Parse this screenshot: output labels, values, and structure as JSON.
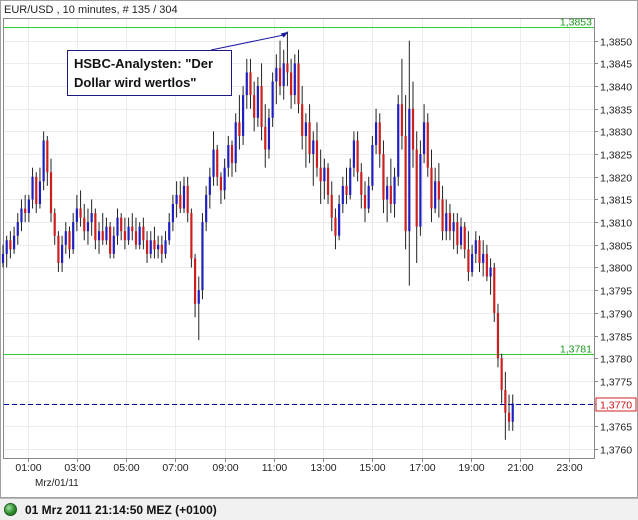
{
  "header": {
    "title": "EUR/USD , 10 minutes, # 135 / 304"
  },
  "annotation": {
    "line1": "HSBC-Analysten: \"Der",
    "line2": "Dollar wird wertlos\""
  },
  "date_label": "Mrz/01/11",
  "status": {
    "text": "01 Mrz 2011 21:14:50  MEZ (+0100)"
  },
  "colors": {
    "up": "#2020c0",
    "down": "#cc2020",
    "hline": "#33cc33",
    "current": "#0000a0",
    "current_box": "#cc2020"
  },
  "chart_data": {
    "type": "candlestick",
    "instrument": "EUR/USD",
    "interval": "10 minutes",
    "xlim": [
      0,
      24
    ],
    "ylim": [
      1.3758,
      1.3855
    ],
    "x_ticks": [
      {
        "v": 1,
        "label": "01:00"
      },
      {
        "v": 3,
        "label": "03:00"
      },
      {
        "v": 5,
        "label": "05:00"
      },
      {
        "v": 7,
        "label": "07:00"
      },
      {
        "v": 9,
        "label": "09:00"
      },
      {
        "v": 11,
        "label": "11:00"
      },
      {
        "v": 13,
        "label": "13:00"
      },
      {
        "v": 15,
        "label": "15:00"
      },
      {
        "v": 17,
        "label": "17:00"
      },
      {
        "v": 19,
        "label": "19:00"
      },
      {
        "v": 21,
        "label": "21:00"
      },
      {
        "v": 23,
        "label": "23:00"
      }
    ],
    "y_ticks": [
      {
        "v": 1.376,
        "label": "1,3760"
      },
      {
        "v": 1.3765,
        "label": "1,3765"
      },
      {
        "v": 1.377,
        "label": "1,3770"
      },
      {
        "v": 1.3775,
        "label": "1,3775"
      },
      {
        "v": 1.378,
        "label": "1,3780"
      },
      {
        "v": 1.3785,
        "label": "1,3785"
      },
      {
        "v": 1.379,
        "label": "1,3790"
      },
      {
        "v": 1.3795,
        "label": "1,3795"
      },
      {
        "v": 1.38,
        "label": "1,3800"
      },
      {
        "v": 1.3805,
        "label": "1,3805"
      },
      {
        "v": 1.381,
        "label": "1,3810"
      },
      {
        "v": 1.3815,
        "label": "1,3815"
      },
      {
        "v": 1.382,
        "label": "1,3820"
      },
      {
        "v": 1.3825,
        "label": "1,3825"
      },
      {
        "v": 1.383,
        "label": "1,3830"
      },
      {
        "v": 1.3835,
        "label": "1,3835"
      },
      {
        "v": 1.384,
        "label": "1,3840"
      },
      {
        "v": 1.3845,
        "label": "1,3845"
      },
      {
        "v": 1.385,
        "label": "1,3850"
      }
    ],
    "hlines": [
      {
        "value": 1.3853,
        "label": "1,3853"
      },
      {
        "value": 1.3781,
        "label": "1,3781"
      }
    ],
    "current_price": {
      "value": 1.377,
      "label": "1,3770"
    },
    "annotation_point": {
      "time": 11.6,
      "value": 1.3852
    },
    "candles": [
      {
        "t": 0.0,
        "o": 1.3801,
        "h": 1.3805,
        "l": 1.38,
        "c": 1.3803
      },
      {
        "t": 0.15,
        "o": 1.3803,
        "h": 1.3807,
        "l": 1.38,
        "c": 1.3806
      },
      {
        "t": 0.3,
        "o": 1.3806,
        "h": 1.3808,
        "l": 1.3802,
        "c": 1.3804
      },
      {
        "t": 0.45,
        "o": 1.3804,
        "h": 1.3809,
        "l": 1.3803,
        "c": 1.3807
      },
      {
        "t": 0.6,
        "o": 1.3807,
        "h": 1.3812,
        "l": 1.3805,
        "c": 1.381
      },
      {
        "t": 0.75,
        "o": 1.381,
        "h": 1.3815,
        "l": 1.3808,
        "c": 1.3813
      },
      {
        "t": 0.9,
        "o": 1.3813,
        "h": 1.3816,
        "l": 1.381,
        "c": 1.3812
      },
      {
        "t": 1.05,
        "o": 1.3812,
        "h": 1.3816,
        "l": 1.381,
        "c": 1.3815
      },
      {
        "t": 1.2,
        "o": 1.3815,
        "h": 1.3822,
        "l": 1.3813,
        "c": 1.382
      },
      {
        "t": 1.35,
        "o": 1.382,
        "h": 1.3821,
        "l": 1.3812,
        "c": 1.3814
      },
      {
        "t": 1.5,
        "o": 1.3814,
        "h": 1.3822,
        "l": 1.3813,
        "c": 1.3819
      },
      {
        "t": 1.65,
        "o": 1.3819,
        "h": 1.383,
        "l": 1.3817,
        "c": 1.3828
      },
      {
        "t": 1.8,
        "o": 1.3828,
        "h": 1.3829,
        "l": 1.3818,
        "c": 1.3821
      },
      {
        "t": 1.95,
        "o": 1.3821,
        "h": 1.3824,
        "l": 1.381,
        "c": 1.3812
      },
      {
        "t": 2.1,
        "o": 1.3812,
        "h": 1.3813,
        "l": 1.3805,
        "c": 1.3807
      },
      {
        "t": 2.25,
        "o": 1.3807,
        "h": 1.3808,
        "l": 1.3799,
        "c": 1.3801
      },
      {
        "t": 2.4,
        "o": 1.3801,
        "h": 1.3807,
        "l": 1.3799,
        "c": 1.3805
      },
      {
        "t": 2.55,
        "o": 1.3805,
        "h": 1.381,
        "l": 1.3803,
        "c": 1.3808
      },
      {
        "t": 2.7,
        "o": 1.3808,
        "h": 1.3809,
        "l": 1.3802,
        "c": 1.3804
      },
      {
        "t": 2.85,
        "o": 1.3804,
        "h": 1.3812,
        "l": 1.3803,
        "c": 1.381
      },
      {
        "t": 3.0,
        "o": 1.381,
        "h": 1.3816,
        "l": 1.3808,
        "c": 1.3813
      },
      {
        "t": 3.15,
        "o": 1.3813,
        "h": 1.3817,
        "l": 1.3809,
        "c": 1.3811
      },
      {
        "t": 3.3,
        "o": 1.3811,
        "h": 1.3814,
        "l": 1.3806,
        "c": 1.3808
      },
      {
        "t": 3.45,
        "o": 1.3808,
        "h": 1.3813,
        "l": 1.3805,
        "c": 1.381
      },
      {
        "t": 3.6,
        "o": 1.381,
        "h": 1.3815,
        "l": 1.3807,
        "c": 1.3812
      },
      {
        "t": 3.75,
        "o": 1.3812,
        "h": 1.3813,
        "l": 1.3804,
        "c": 1.3806
      },
      {
        "t": 3.9,
        "o": 1.3806,
        "h": 1.381,
        "l": 1.3803,
        "c": 1.3808
      },
      {
        "t": 4.05,
        "o": 1.3808,
        "h": 1.3812,
        "l": 1.3805,
        "c": 1.3806
      },
      {
        "t": 4.2,
        "o": 1.3806,
        "h": 1.3811,
        "l": 1.3805,
        "c": 1.3809
      },
      {
        "t": 4.35,
        "o": 1.3809,
        "h": 1.381,
        "l": 1.3802,
        "c": 1.3803
      },
      {
        "t": 4.5,
        "o": 1.3803,
        "h": 1.3809,
        "l": 1.3802,
        "c": 1.3807
      },
      {
        "t": 4.65,
        "o": 1.3807,
        "h": 1.3813,
        "l": 1.3805,
        "c": 1.3811
      },
      {
        "t": 4.8,
        "o": 1.3811,
        "h": 1.3812,
        "l": 1.3806,
        "c": 1.3808
      },
      {
        "t": 4.95,
        "o": 1.3808,
        "h": 1.3811,
        "l": 1.3804,
        "c": 1.3806
      },
      {
        "t": 5.1,
        "o": 1.3806,
        "h": 1.3811,
        "l": 1.3805,
        "c": 1.3809
      },
      {
        "t": 5.25,
        "o": 1.3809,
        "h": 1.3812,
        "l": 1.3806,
        "c": 1.3808
      },
      {
        "t": 5.4,
        "o": 1.3808,
        "h": 1.3811,
        "l": 1.3804,
        "c": 1.3805
      },
      {
        "t": 5.55,
        "o": 1.3805,
        "h": 1.381,
        "l": 1.3804,
        "c": 1.3809
      },
      {
        "t": 5.7,
        "o": 1.3809,
        "h": 1.3811,
        "l": 1.3804,
        "c": 1.3806
      },
      {
        "t": 5.85,
        "o": 1.3806,
        "h": 1.3808,
        "l": 1.3801,
        "c": 1.3803
      },
      {
        "t": 6.0,
        "o": 1.3803,
        "h": 1.3808,
        "l": 1.3802,
        "c": 1.3806
      },
      {
        "t": 6.15,
        "o": 1.3806,
        "h": 1.3809,
        "l": 1.3802,
        "c": 1.3804
      },
      {
        "t": 6.3,
        "o": 1.3804,
        "h": 1.3807,
        "l": 1.3802,
        "c": 1.3805
      },
      {
        "t": 6.45,
        "o": 1.3805,
        "h": 1.3807,
        "l": 1.3801,
        "c": 1.3803
      },
      {
        "t": 6.6,
        "o": 1.3803,
        "h": 1.3808,
        "l": 1.3802,
        "c": 1.3806
      },
      {
        "t": 6.75,
        "o": 1.3806,
        "h": 1.3812,
        "l": 1.3805,
        "c": 1.381
      },
      {
        "t": 6.9,
        "o": 1.381,
        "h": 1.3816,
        "l": 1.3808,
        "c": 1.3814
      },
      {
        "t": 7.05,
        "o": 1.3814,
        "h": 1.3819,
        "l": 1.3811,
        "c": 1.3816
      },
      {
        "t": 7.2,
        "o": 1.3816,
        "h": 1.3819,
        "l": 1.3812,
        "c": 1.3813
      },
      {
        "t": 7.35,
        "o": 1.3813,
        "h": 1.382,
        "l": 1.3812,
        "c": 1.3818
      },
      {
        "t": 7.5,
        "o": 1.3818,
        "h": 1.382,
        "l": 1.381,
        "c": 1.3812
      },
      {
        "t": 7.65,
        "o": 1.3812,
        "h": 1.3813,
        "l": 1.38,
        "c": 1.3802
      },
      {
        "t": 7.8,
        "o": 1.3802,
        "h": 1.3803,
        "l": 1.3789,
        "c": 1.3792
      },
      {
        "t": 7.95,
        "o": 1.3792,
        "h": 1.3798,
        "l": 1.3784,
        "c": 1.3795
      },
      {
        "t": 8.1,
        "o": 1.3795,
        "h": 1.3812,
        "l": 1.3793,
        "c": 1.381
      },
      {
        "t": 8.25,
        "o": 1.381,
        "h": 1.3818,
        "l": 1.3808,
        "c": 1.3816
      },
      {
        "t": 8.4,
        "o": 1.3816,
        "h": 1.3822,
        "l": 1.3813,
        "c": 1.382
      },
      {
        "t": 8.55,
        "o": 1.382,
        "h": 1.383,
        "l": 1.3818,
        "c": 1.3826
      },
      {
        "t": 8.7,
        "o": 1.3826,
        "h": 1.3827,
        "l": 1.3818,
        "c": 1.382
      },
      {
        "t": 8.85,
        "o": 1.382,
        "h": 1.3821,
        "l": 1.3814,
        "c": 1.3817
      },
      {
        "t": 9.0,
        "o": 1.3817,
        "h": 1.3824,
        "l": 1.3815,
        "c": 1.3822
      },
      {
        "t": 9.15,
        "o": 1.3822,
        "h": 1.3829,
        "l": 1.382,
        "c": 1.3827
      },
      {
        "t": 9.3,
        "o": 1.3827,
        "h": 1.3828,
        "l": 1.382,
        "c": 1.3823
      },
      {
        "t": 9.45,
        "o": 1.3823,
        "h": 1.3834,
        "l": 1.3821,
        "c": 1.3832
      },
      {
        "t": 9.6,
        "o": 1.3832,
        "h": 1.3838,
        "l": 1.3826,
        "c": 1.3829
      },
      {
        "t": 9.75,
        "o": 1.3829,
        "h": 1.384,
        "l": 1.3827,
        "c": 1.3838
      },
      {
        "t": 9.9,
        "o": 1.3838,
        "h": 1.3846,
        "l": 1.3835,
        "c": 1.3843
      },
      {
        "t": 10.05,
        "o": 1.3843,
        "h": 1.3846,
        "l": 1.3835,
        "c": 1.3838
      },
      {
        "t": 10.2,
        "o": 1.3838,
        "h": 1.3841,
        "l": 1.383,
        "c": 1.3833
      },
      {
        "t": 10.35,
        "o": 1.3833,
        "h": 1.3842,
        "l": 1.3831,
        "c": 1.384
      },
      {
        "t": 10.5,
        "o": 1.384,
        "h": 1.3845,
        "l": 1.3828,
        "c": 1.3831
      },
      {
        "t": 10.65,
        "o": 1.3831,
        "h": 1.3836,
        "l": 1.3822,
        "c": 1.3826
      },
      {
        "t": 10.8,
        "o": 1.3826,
        "h": 1.3835,
        "l": 1.3824,
        "c": 1.3833
      },
      {
        "t": 10.95,
        "o": 1.3833,
        "h": 1.3843,
        "l": 1.3831,
        "c": 1.3841
      },
      {
        "t": 11.1,
        "o": 1.3841,
        "h": 1.3847,
        "l": 1.3836,
        "c": 1.3844
      },
      {
        "t": 11.25,
        "o": 1.3844,
        "h": 1.385,
        "l": 1.3838,
        "c": 1.384
      },
      {
        "t": 11.4,
        "o": 1.384,
        "h": 1.3848,
        "l": 1.3837,
        "c": 1.3845
      },
      {
        "t": 11.55,
        "o": 1.3845,
        "h": 1.3852,
        "l": 1.384,
        "c": 1.3843
      },
      {
        "t": 11.7,
        "o": 1.3843,
        "h": 1.3846,
        "l": 1.3835,
        "c": 1.3838
      },
      {
        "t": 11.85,
        "o": 1.3838,
        "h": 1.3847,
        "l": 1.3836,
        "c": 1.3845
      },
      {
        "t": 12.0,
        "o": 1.3845,
        "h": 1.3848,
        "l": 1.3834,
        "c": 1.3836
      },
      {
        "t": 12.15,
        "o": 1.3836,
        "h": 1.384,
        "l": 1.3826,
        "c": 1.3829
      },
      {
        "t": 12.3,
        "o": 1.3829,
        "h": 1.3834,
        "l": 1.3822,
        "c": 1.3832
      },
      {
        "t": 12.45,
        "o": 1.3832,
        "h": 1.3836,
        "l": 1.3823,
        "c": 1.3825
      },
      {
        "t": 12.6,
        "o": 1.3825,
        "h": 1.383,
        "l": 1.3818,
        "c": 1.3828
      },
      {
        "t": 12.75,
        "o": 1.3828,
        "h": 1.3832,
        "l": 1.382,
        "c": 1.3822
      },
      {
        "t": 12.9,
        "o": 1.3822,
        "h": 1.3826,
        "l": 1.3814,
        "c": 1.3819
      },
      {
        "t": 13.05,
        "o": 1.3819,
        "h": 1.3824,
        "l": 1.3815,
        "c": 1.3822
      },
      {
        "t": 13.2,
        "o": 1.3822,
        "h": 1.3823,
        "l": 1.3814,
        "c": 1.3816
      },
      {
        "t": 13.35,
        "o": 1.3816,
        "h": 1.3819,
        "l": 1.3808,
        "c": 1.3811
      },
      {
        "t": 13.5,
        "o": 1.3811,
        "h": 1.3813,
        "l": 1.3804,
        "c": 1.3807
      },
      {
        "t": 13.65,
        "o": 1.3807,
        "h": 1.3816,
        "l": 1.3806,
        "c": 1.3814
      },
      {
        "t": 13.8,
        "o": 1.3814,
        "h": 1.382,
        "l": 1.3812,
        "c": 1.3818
      },
      {
        "t": 13.95,
        "o": 1.3818,
        "h": 1.3822,
        "l": 1.3814,
        "c": 1.3816
      },
      {
        "t": 14.1,
        "o": 1.3816,
        "h": 1.3824,
        "l": 1.3815,
        "c": 1.3822
      },
      {
        "t": 14.25,
        "o": 1.3822,
        "h": 1.383,
        "l": 1.382,
        "c": 1.3828
      },
      {
        "t": 14.4,
        "o": 1.3828,
        "h": 1.383,
        "l": 1.3819,
        "c": 1.3821
      },
      {
        "t": 14.55,
        "o": 1.3821,
        "h": 1.3823,
        "l": 1.3813,
        "c": 1.3816
      },
      {
        "t": 14.7,
        "o": 1.3816,
        "h": 1.3819,
        "l": 1.381,
        "c": 1.3813
      },
      {
        "t": 14.85,
        "o": 1.3813,
        "h": 1.382,
        "l": 1.3812,
        "c": 1.3818
      },
      {
        "t": 15.0,
        "o": 1.3818,
        "h": 1.3829,
        "l": 1.3817,
        "c": 1.3827
      },
      {
        "t": 15.15,
        "o": 1.3827,
        "h": 1.3835,
        "l": 1.3825,
        "c": 1.3832
      },
      {
        "t": 15.3,
        "o": 1.3832,
        "h": 1.3834,
        "l": 1.3822,
        "c": 1.3825
      },
      {
        "t": 15.45,
        "o": 1.3825,
        "h": 1.3828,
        "l": 1.3812,
        "c": 1.3815
      },
      {
        "t": 15.6,
        "o": 1.3815,
        "h": 1.382,
        "l": 1.381,
        "c": 1.3818
      },
      {
        "t": 15.75,
        "o": 1.3818,
        "h": 1.3824,
        "l": 1.3812,
        "c": 1.3814
      },
      {
        "t": 15.9,
        "o": 1.3814,
        "h": 1.3822,
        "l": 1.3811,
        "c": 1.382
      },
      {
        "t": 16.05,
        "o": 1.382,
        "h": 1.3838,
        "l": 1.3818,
        "c": 1.3836
      },
      {
        "t": 16.2,
        "o": 1.3836,
        "h": 1.3846,
        "l": 1.3826,
        "c": 1.3829
      },
      {
        "t": 16.35,
        "o": 1.3829,
        "h": 1.3838,
        "l": 1.3804,
        "c": 1.3808
      },
      {
        "t": 16.5,
        "o": 1.3808,
        "h": 1.385,
        "l": 1.3796,
        "c": 1.3835
      },
      {
        "t": 16.65,
        "o": 1.3835,
        "h": 1.3841,
        "l": 1.3822,
        "c": 1.3826
      },
      {
        "t": 16.8,
        "o": 1.3826,
        "h": 1.383,
        "l": 1.3801,
        "c": 1.3809
      },
      {
        "t": 16.95,
        "o": 1.3809,
        "h": 1.3828,
        "l": 1.3807,
        "c": 1.3825
      },
      {
        "t": 17.1,
        "o": 1.3825,
        "h": 1.3836,
        "l": 1.3823,
        "c": 1.3832
      },
      {
        "t": 17.25,
        "o": 1.3832,
        "h": 1.3834,
        "l": 1.382,
        "c": 1.3822
      },
      {
        "t": 17.4,
        "o": 1.3822,
        "h": 1.3826,
        "l": 1.381,
        "c": 1.3813
      },
      {
        "t": 17.55,
        "o": 1.3813,
        "h": 1.3822,
        "l": 1.3812,
        "c": 1.3819
      },
      {
        "t": 17.7,
        "o": 1.3819,
        "h": 1.3823,
        "l": 1.3811,
        "c": 1.3815
      },
      {
        "t": 17.85,
        "o": 1.3815,
        "h": 1.3818,
        "l": 1.3806,
        "c": 1.3808
      },
      {
        "t": 18.0,
        "o": 1.3808,
        "h": 1.3815,
        "l": 1.3806,
        "c": 1.3812
      },
      {
        "t": 18.15,
        "o": 1.3812,
        "h": 1.3814,
        "l": 1.3806,
        "c": 1.3808
      },
      {
        "t": 18.3,
        "o": 1.3808,
        "h": 1.3812,
        "l": 1.3804,
        "c": 1.381
      },
      {
        "t": 18.45,
        "o": 1.381,
        "h": 1.3812,
        "l": 1.3803,
        "c": 1.3805
      },
      {
        "t": 18.6,
        "o": 1.3805,
        "h": 1.3811,
        "l": 1.3804,
        "c": 1.3809
      },
      {
        "t": 18.75,
        "o": 1.3809,
        "h": 1.381,
        "l": 1.3802,
        "c": 1.3804
      },
      {
        "t": 18.9,
        "o": 1.3804,
        "h": 1.3808,
        "l": 1.3797,
        "c": 1.3799
      },
      {
        "t": 19.05,
        "o": 1.3799,
        "h": 1.3805,
        "l": 1.3798,
        "c": 1.3803
      },
      {
        "t": 19.2,
        "o": 1.3803,
        "h": 1.3808,
        "l": 1.3801,
        "c": 1.3806
      },
      {
        "t": 19.35,
        "o": 1.3806,
        "h": 1.3807,
        "l": 1.3799,
        "c": 1.3801
      },
      {
        "t": 19.5,
        "o": 1.3801,
        "h": 1.3806,
        "l": 1.3798,
        "c": 1.3803
      },
      {
        "t": 19.65,
        "o": 1.3803,
        "h": 1.3805,
        "l": 1.3797,
        "c": 1.3798
      },
      {
        "t": 19.8,
        "o": 1.3798,
        "h": 1.3802,
        "l": 1.3794,
        "c": 1.38
      },
      {
        "t": 19.95,
        "o": 1.38,
        "h": 1.3801,
        "l": 1.3788,
        "c": 1.379
      },
      {
        "t": 20.1,
        "o": 1.379,
        "h": 1.3792,
        "l": 1.3778,
        "c": 1.378
      },
      {
        "t": 20.25,
        "o": 1.378,
        "h": 1.3781,
        "l": 1.377,
        "c": 1.3773
      },
      {
        "t": 20.4,
        "o": 1.3773,
        "h": 1.3777,
        "l": 1.3762,
        "c": 1.3768
      },
      {
        "t": 20.55,
        "o": 1.3768,
        "h": 1.3772,
        "l": 1.3764,
        "c": 1.3766
      },
      {
        "t": 20.7,
        "o": 1.3766,
        "h": 1.3772,
        "l": 1.3764,
        "c": 1.377
      }
    ]
  }
}
